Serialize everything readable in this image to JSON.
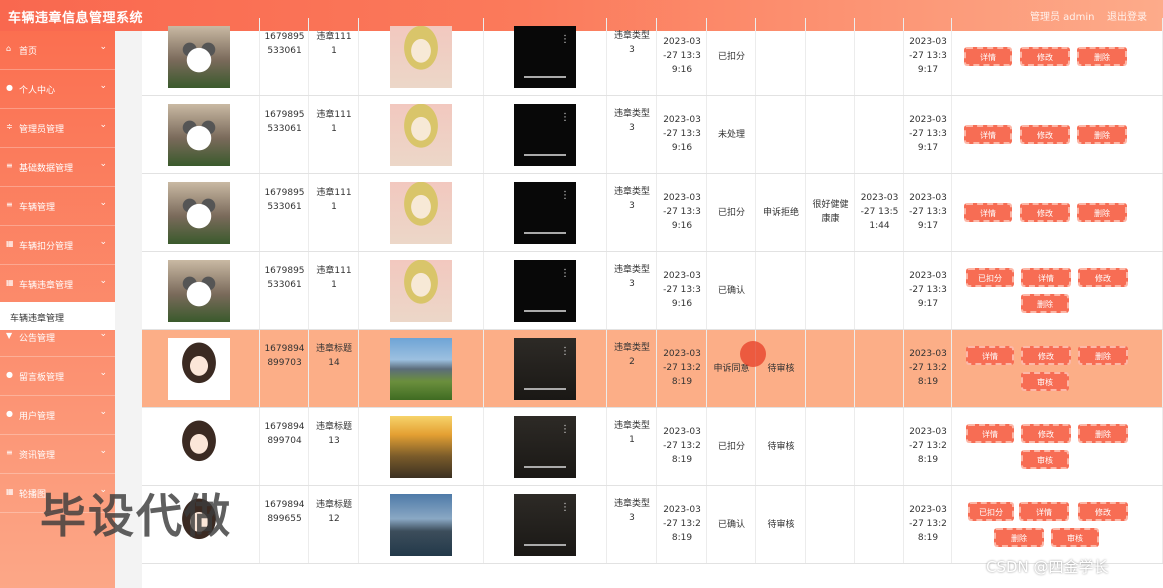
{
  "header": {
    "title": "车辆违章信息管理系统",
    "admin": "管理员 admin",
    "logout": "退出登录"
  },
  "sidebar": {
    "items": [
      {
        "label": "首页",
        "icon": "home-icon"
      },
      {
        "label": "个人中心",
        "icon": "user-icon"
      },
      {
        "label": "管理员管理",
        "icon": "admin-icon"
      },
      {
        "label": "基础数据管理",
        "icon": "list-icon"
      },
      {
        "label": "车辆管理",
        "icon": "list-icon"
      },
      {
        "label": "车辆扣分管理",
        "icon": "grid-icon"
      },
      {
        "label": "车辆违章管理",
        "icon": "grid-icon"
      },
      {
        "label": "公告管理",
        "icon": "notice-icon"
      },
      {
        "label": "留言板管理",
        "icon": "user-icon"
      },
      {
        "label": "用户管理",
        "icon": "user-icon"
      },
      {
        "label": "资讯管理",
        "icon": "list-icon"
      },
      {
        "label": "轮播图",
        "icon": "grid-icon"
      }
    ],
    "subitem": "车辆违章管理"
  },
  "rows": [
    {
      "img1": "cat",
      "id": "1679895\n533061",
      "title": "违章111\n1",
      "img2": "anime",
      "video": "dark",
      "type": "违章类型\n3",
      "time": "2023-03\n-27 13:3\n9:16",
      "status": "已扣分",
      "appeal": "",
      "reason": "",
      "reply_time": "",
      "created": "2023-03\n-27 13:3\n9:17",
      "buttons": [
        "详情",
        "修改",
        "删除"
      ]
    },
    {
      "img1": "cat",
      "id": "1679895\n533061",
      "title": "违章111\n1",
      "img2": "anime",
      "video": "dark",
      "type": "违章类型\n3",
      "time": "2023-03\n-27 13:3\n9:16",
      "status": "未处理",
      "appeal": "",
      "reason": "",
      "reply_time": "",
      "created": "2023-03\n-27 13:3\n9:17",
      "buttons": [
        "详情",
        "修改",
        "删除"
      ]
    },
    {
      "img1": "cat",
      "id": "1679895\n533061",
      "title": "违章111\n1",
      "img2": "anime",
      "video": "dark",
      "type": "违章类型\n3",
      "time": "2023-03\n-27 13:3\n9:16",
      "status": "已扣分",
      "appeal": "申诉拒绝",
      "reason": "很好健健\n康康",
      "reply_time": "2023-03\n-27 13:5\n1:44",
      "created": "2023-03\n-27 13:3\n9:17",
      "buttons": [
        "详情",
        "修改",
        "删除"
      ]
    },
    {
      "img1": "cat",
      "id": "1679895\n533061",
      "title": "违章111\n1",
      "img2": "anime",
      "video": "dark",
      "type": "违章类型\n3",
      "time": "2023-03\n-27 13:3\n9:16",
      "status": "已确认",
      "appeal": "",
      "reason": "",
      "reply_time": "",
      "created": "2023-03\n-27 13:3\n9:17",
      "buttons": [
        "已扣分",
        "详情",
        "修改",
        "删除"
      ]
    },
    {
      "img1": "girl",
      "id": "1679894\n899703",
      "title": "违章标题\n14",
      "img2": "land1",
      "video": "room",
      "type": "违章类型\n2",
      "time": "2023-03\n-27 13:2\n8:19",
      "status": "申诉同意",
      "appeal": "待审核",
      "reason": "",
      "reply_time": "",
      "created": "2023-03\n-27 13:2\n8:19",
      "buttons": [
        "详情",
        "修改",
        "删除",
        "审核"
      ]
    },
    {
      "img1": "girl",
      "id": "1679894\n899704",
      "title": "违章标题\n13",
      "img2": "land2",
      "video": "room",
      "type": "违章类型\n1",
      "time": "2023-03\n-27 13:2\n8:19",
      "status": "已扣分",
      "appeal": "待审核",
      "reason": "",
      "reply_time": "",
      "created": "2023-03\n-27 13:2\n8:19",
      "buttons": [
        "详情",
        "修改",
        "删除",
        "审核"
      ]
    },
    {
      "img1": "girl",
      "id": "1679894\n899655",
      "title": "违章标题\n12",
      "img2": "land3",
      "video": "room",
      "type": "违章类型\n3",
      "time": "2023-03\n-27 13:2\n8:19",
      "status": "已确认",
      "appeal": "待审核",
      "reason": "",
      "reply_time": "",
      "created": "2023-03\n-27 13:2\n8:19",
      "buttons": [
        "已扣分",
        "详情",
        "修改",
        "删除",
        "审核"
      ]
    }
  ],
  "overlay": {
    "watermark": "毕设代做",
    "credit": "CSDN @四金学长"
  },
  "colors": {
    "accent": "#f76d54",
    "highlight_row": "#fcae87",
    "sidebar_top": "#fb6f50",
    "sidebar_bottom": "#fca787"
  }
}
